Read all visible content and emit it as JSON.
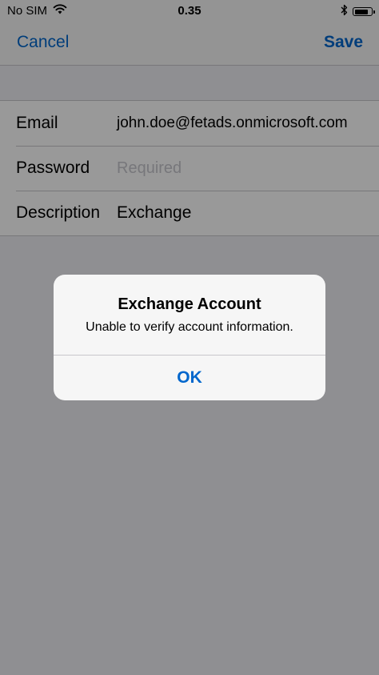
{
  "status_bar": {
    "carrier": "No SIM",
    "time": "0.35",
    "icons": [
      "wifi-icon",
      "bluetooth-icon",
      "battery-icon"
    ],
    "battery_level": 0.85
  },
  "nav": {
    "cancel_label": "Cancel",
    "save_label": "Save"
  },
  "form": {
    "email_label": "Email",
    "email_value": "john.doe@fetads.onmicrosoft.com",
    "password_label": "Password",
    "password_placeholder": "Required",
    "description_label": "Description",
    "description_value": "Exchange"
  },
  "alert": {
    "title": "Exchange Account",
    "message": "Unable to verify account information.",
    "ok_label": "OK"
  },
  "colors": {
    "accent": "#0066cc",
    "background": "#efeff4",
    "separator": "#c8c7cc",
    "placeholder": "#c7c7cd"
  }
}
